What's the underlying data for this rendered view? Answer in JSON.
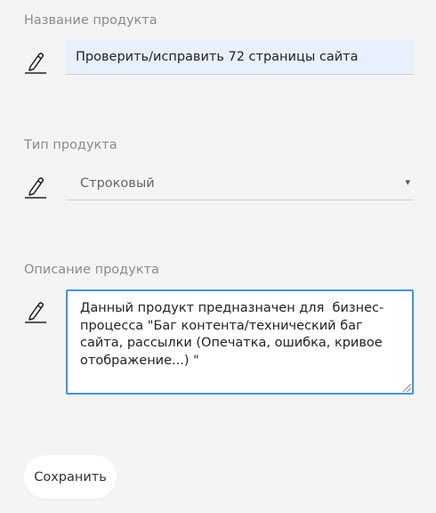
{
  "form": {
    "name": {
      "label": "Название продукта",
      "value": "Проверить/исправить 72 страницы сайта",
      "icon": "pencil-icon"
    },
    "type": {
      "label": "Тип продукта",
      "value": "Строковый",
      "caret": "▾",
      "icon": "pencil-icon"
    },
    "description": {
      "label": "Описание продукта",
      "value": "Данный продукт предназначен для  бизнес-процесса \"Баг контента/технический баг сайта, рассылки (Опечатка, ошибка, кривое отображение...) \"",
      "icon": "pencil-icon"
    },
    "save_label": "Сохранить"
  },
  "colors": {
    "background": "#f4f4f4",
    "input_autofill": "#e8f0fe",
    "focus_border": "#4a90d9",
    "label": "#8b8b8b"
  }
}
